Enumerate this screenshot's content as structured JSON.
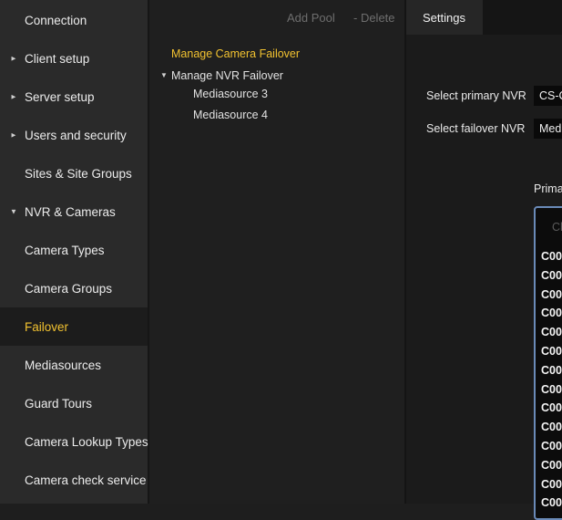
{
  "sidebar": {
    "items": [
      {
        "label": "Connection",
        "caret": ""
      },
      {
        "label": "Client setup",
        "caret": "►"
      },
      {
        "label": "Server setup",
        "caret": "►"
      },
      {
        "label": "Users and security",
        "caret": "►"
      },
      {
        "label": "Sites & Site Groups",
        "caret": ""
      },
      {
        "label": "NVR & Cameras",
        "caret": "▼"
      },
      {
        "label": "Camera Types",
        "caret": ""
      },
      {
        "label": "Camera Groups",
        "caret": ""
      },
      {
        "label": "Failover",
        "caret": "",
        "active": true
      },
      {
        "label": "Mediasources",
        "caret": ""
      },
      {
        "label": "Guard Tours",
        "caret": ""
      },
      {
        "label": "Camera Lookup Types",
        "caret": ""
      },
      {
        "label": "Camera check service",
        "caret": ""
      }
    ]
  },
  "toolbar": {
    "add_pool": "Add Pool",
    "delete": "- Delete"
  },
  "tree": {
    "manage_camera_failover": "Manage Camera Failover",
    "manage_nvr_failover": "Manage NVR Failover",
    "nvr_caret": "▼",
    "children": [
      "Mediasource 3",
      "Mediasource 4"
    ]
  },
  "settings": {
    "tab_label": "Settings",
    "primary_nvr_label": "Select primary NVR",
    "primary_nvr_value": "CS-C",
    "failover_nvr_label": "Select failover NVR",
    "failover_nvr_value": "Medi",
    "list_label": "Prima",
    "list_search_placeholder": "Ch",
    "list_items": [
      "C00",
      "C00",
      "C00",
      "C00",
      "C00",
      "C00",
      "C00",
      "C00",
      "C00",
      "C00",
      "C00",
      "C00",
      "C00",
      "C00"
    ]
  },
  "colors": {
    "accent": "#f2c230",
    "list_border": "#6a8ab8"
  }
}
